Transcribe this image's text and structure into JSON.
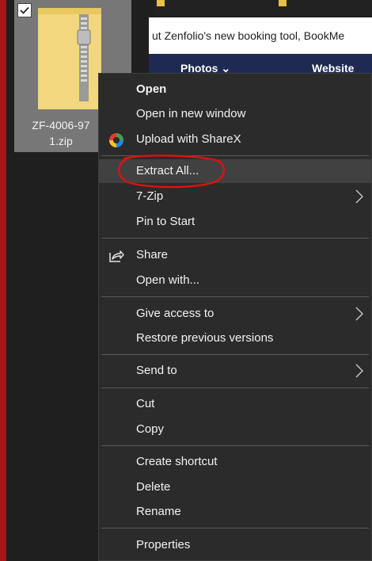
{
  "desktop": {
    "file": {
      "name_line1": "ZF-4006-97",
      "name_line2": "1.zip",
      "selected": true,
      "icon": "zip-folder-icon"
    }
  },
  "browser": {
    "page_text": "ut Zenfolio's new booking tool, BookMe",
    "nav": {
      "item1": "Photos ⌄",
      "item2": "Website"
    }
  },
  "context_menu": {
    "open": "Open",
    "open_new_window": "Open in new window",
    "upload_sharex": "Upload with ShareX",
    "extract_all": "Extract All...",
    "seven_zip": "7-Zip",
    "pin_to_start": "Pin to Start",
    "share": "Share",
    "open_with": "Open with...",
    "give_access": "Give access to",
    "restore_versions": "Restore previous versions",
    "send_to": "Send to",
    "cut": "Cut",
    "copy": "Copy",
    "create_shortcut": "Create shortcut",
    "delete": "Delete",
    "rename": "Rename",
    "properties": "Properties",
    "highlighted_item": "Extract All..."
  },
  "colors": {
    "menu_bg": "#2b2b2b",
    "menu_hover": "#414141",
    "annotation": "#e01010",
    "tile_selected": "#777777",
    "nav_bg": "#1e2a52"
  }
}
